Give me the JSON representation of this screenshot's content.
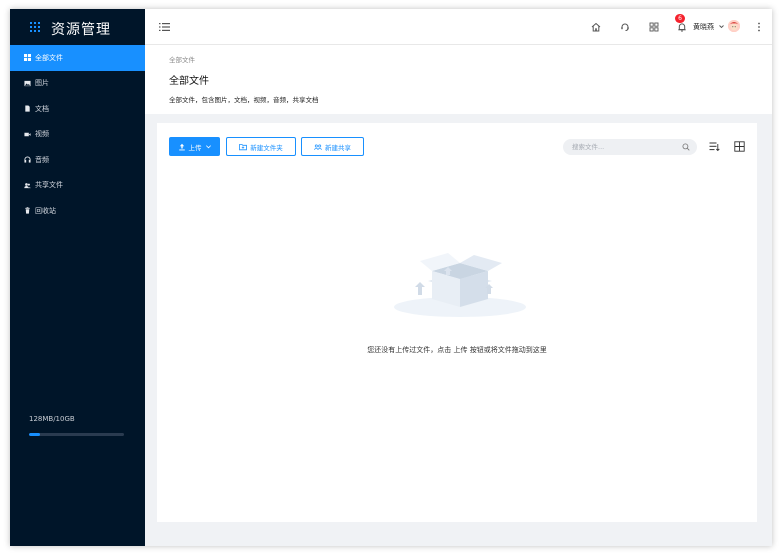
{
  "app": {
    "title": "资源管理"
  },
  "sidebar": {
    "items": [
      {
        "label": "全部文件",
        "icon": "grid-icon",
        "active": true
      },
      {
        "label": "图片",
        "icon": "image-icon",
        "active": false
      },
      {
        "label": "文档",
        "icon": "document-icon",
        "active": false
      },
      {
        "label": "视频",
        "icon": "video-icon",
        "active": false
      },
      {
        "label": "音频",
        "icon": "headphones-icon",
        "active": false
      },
      {
        "label": "共享文件",
        "icon": "users-icon",
        "active": false
      },
      {
        "label": "回收站",
        "icon": "trash-icon",
        "active": false
      }
    ],
    "storage": {
      "text": "128MB/10GB",
      "used_fraction": 0.0125
    }
  },
  "topbar": {
    "notification_count": "6",
    "user_name": "黄晓燕"
  },
  "page": {
    "breadcrumb": "全部文件",
    "title": "全部文件",
    "description": "全部文件，包含图片，文档，视频，音频，共享文档"
  },
  "toolbar": {
    "upload_label": "上传",
    "new_folder_label": "新建文件夹",
    "new_share_label": "新建共享",
    "search_placeholder": "搜索文件..."
  },
  "empty_state": {
    "message": "您还没有上传过文件，点击 上传 按钮或将文件拖动到这里"
  },
  "colors": {
    "accent": "#1890ff",
    "sidebar_bg": "#001529",
    "badge": "#f5222d",
    "page_bg": "#f0f2f5"
  }
}
